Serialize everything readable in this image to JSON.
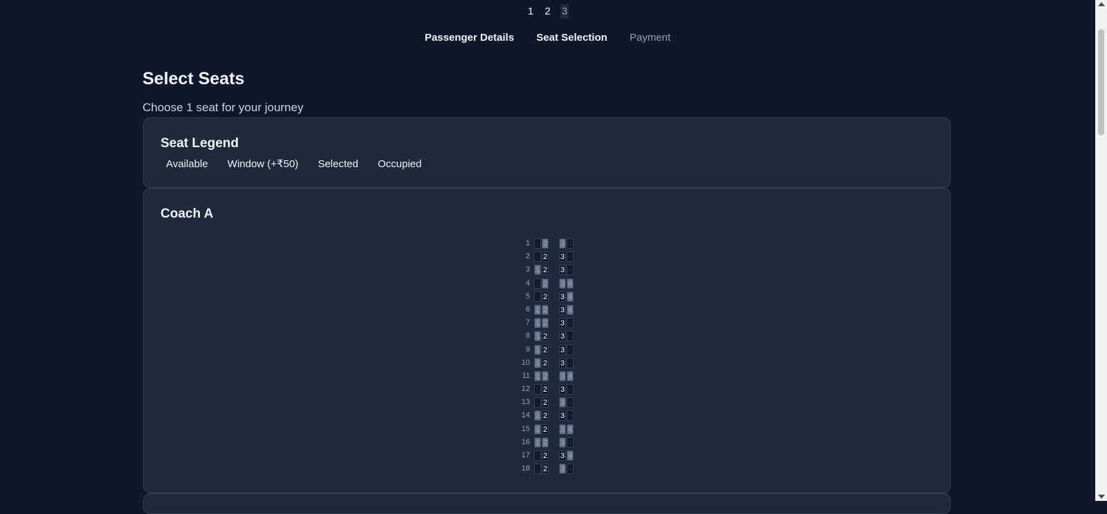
{
  "steps": {
    "numbers": [
      "1",
      "2",
      "3"
    ],
    "labels": [
      "Passenger Details",
      "Seat Selection",
      "Payment"
    ]
  },
  "page": {
    "title": "Select Seats",
    "subtitle": "Choose 1 seat for your journey"
  },
  "legend": {
    "title": "Seat Legend",
    "items": [
      "Available",
      "Window (+₹50)",
      "Selected",
      "Occupied"
    ]
  },
  "coach": {
    "title": "Coach A",
    "rows": [
      {
        "num": "1",
        "seats": [
          "window",
          "occupied",
          "occupied",
          "window"
        ]
      },
      {
        "num": "2",
        "seats": [
          "window",
          "available",
          "available",
          "window"
        ]
      },
      {
        "num": "3",
        "seats": [
          "occupied",
          "available",
          "available",
          "window"
        ]
      },
      {
        "num": "4",
        "seats": [
          "window",
          "occupied",
          "occupied",
          "occupied"
        ]
      },
      {
        "num": "5",
        "seats": [
          "window",
          "available",
          "available",
          "occupied"
        ]
      },
      {
        "num": "6",
        "seats": [
          "occupied",
          "occupied",
          "available",
          "occupied"
        ]
      },
      {
        "num": "7",
        "seats": [
          "occupied",
          "occupied",
          "available",
          "window"
        ]
      },
      {
        "num": "8",
        "seats": [
          "occupied",
          "available",
          "available",
          "window"
        ]
      },
      {
        "num": "9",
        "seats": [
          "occupied",
          "available",
          "available",
          "window"
        ]
      },
      {
        "num": "10",
        "seats": [
          "occupied",
          "available",
          "available",
          "window"
        ]
      },
      {
        "num": "11",
        "seats": [
          "occupied",
          "occupied",
          "occupied",
          "occupied"
        ]
      },
      {
        "num": "12",
        "seats": [
          "window",
          "available",
          "available",
          "window"
        ]
      },
      {
        "num": "13",
        "seats": [
          "window",
          "available",
          "occupied",
          "window"
        ]
      },
      {
        "num": "14",
        "seats": [
          "occupied",
          "available",
          "available",
          "window"
        ]
      },
      {
        "num": "15",
        "seats": [
          "occupied",
          "available",
          "occupied",
          "occupied"
        ]
      },
      {
        "num": "16",
        "seats": [
          "occupied",
          "occupied",
          "occupied",
          "window"
        ]
      },
      {
        "num": "17",
        "seats": [
          "window",
          "available",
          "available",
          "occupied"
        ]
      },
      {
        "num": "18",
        "seats": [
          "window",
          "available",
          "occupied",
          "window"
        ]
      }
    ]
  }
}
